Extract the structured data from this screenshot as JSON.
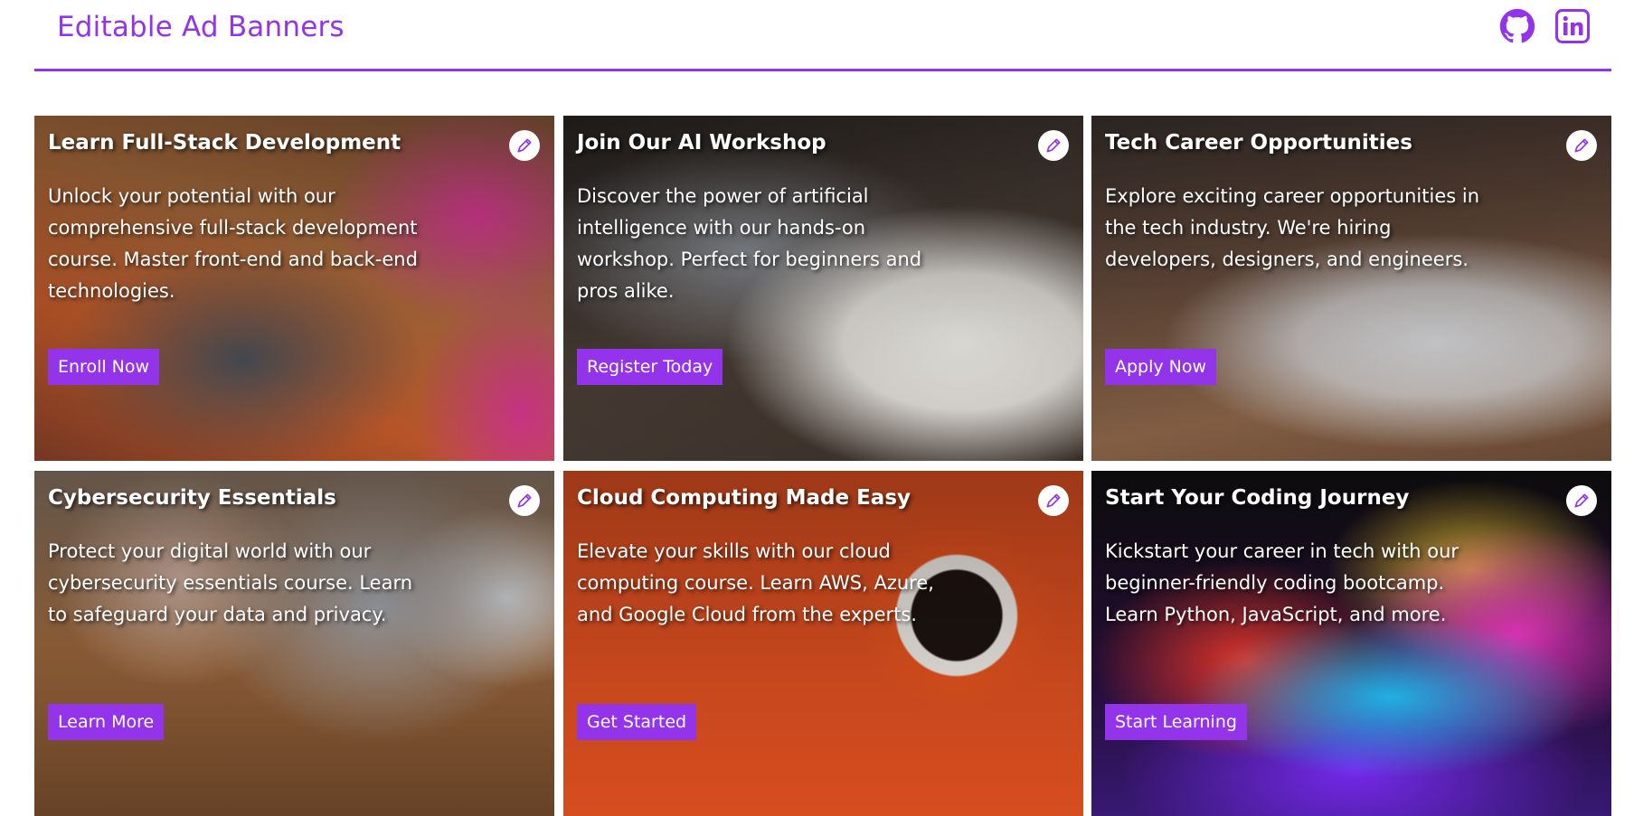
{
  "header": {
    "title": "Editable Ad Banners",
    "github_icon": "github-icon",
    "linkedin_icon": "linkedin-icon"
  },
  "colors": {
    "accent": "#9333ea",
    "card_text": "#ffffff"
  },
  "banners": [
    {
      "title": "Learn Full-Stack Development",
      "description": "Unlock your potential with our comprehensive full-stack development course. Master front-end and back-end technologies.",
      "button": "Enroll Now",
      "edit_icon": "pencil-icon"
    },
    {
      "title": "Join Our AI Workshop",
      "description": "Discover the power of artificial intelligence with our hands-on workshop. Perfect for beginners and pros alike.",
      "button": "Register Today",
      "edit_icon": "pencil-icon"
    },
    {
      "title": "Tech Career Opportunities",
      "description": "Explore exciting career opportunities in the tech industry. We're hiring developers, designers, and engineers.",
      "button": "Apply Now",
      "edit_icon": "pencil-icon"
    },
    {
      "title": "Cybersecurity Essentials",
      "description": "Protect your digital world with our cybersecurity essentials course. Learn to safeguard your data and privacy.",
      "button": "Learn More",
      "edit_icon": "pencil-icon"
    },
    {
      "title": "Cloud Computing Made Easy",
      "description": "Elevate your skills with our cloud computing course. Learn AWS, Azure, and Google Cloud from the experts.",
      "button": "Get Started",
      "edit_icon": "pencil-icon"
    },
    {
      "title": "Start Your Coding Journey",
      "description": "Kickstart your career in tech with our beginner-friendly coding bootcamp. Learn Python, JavaScript, and more.",
      "button": "Start Learning",
      "edit_icon": "pencil-icon"
    }
  ]
}
